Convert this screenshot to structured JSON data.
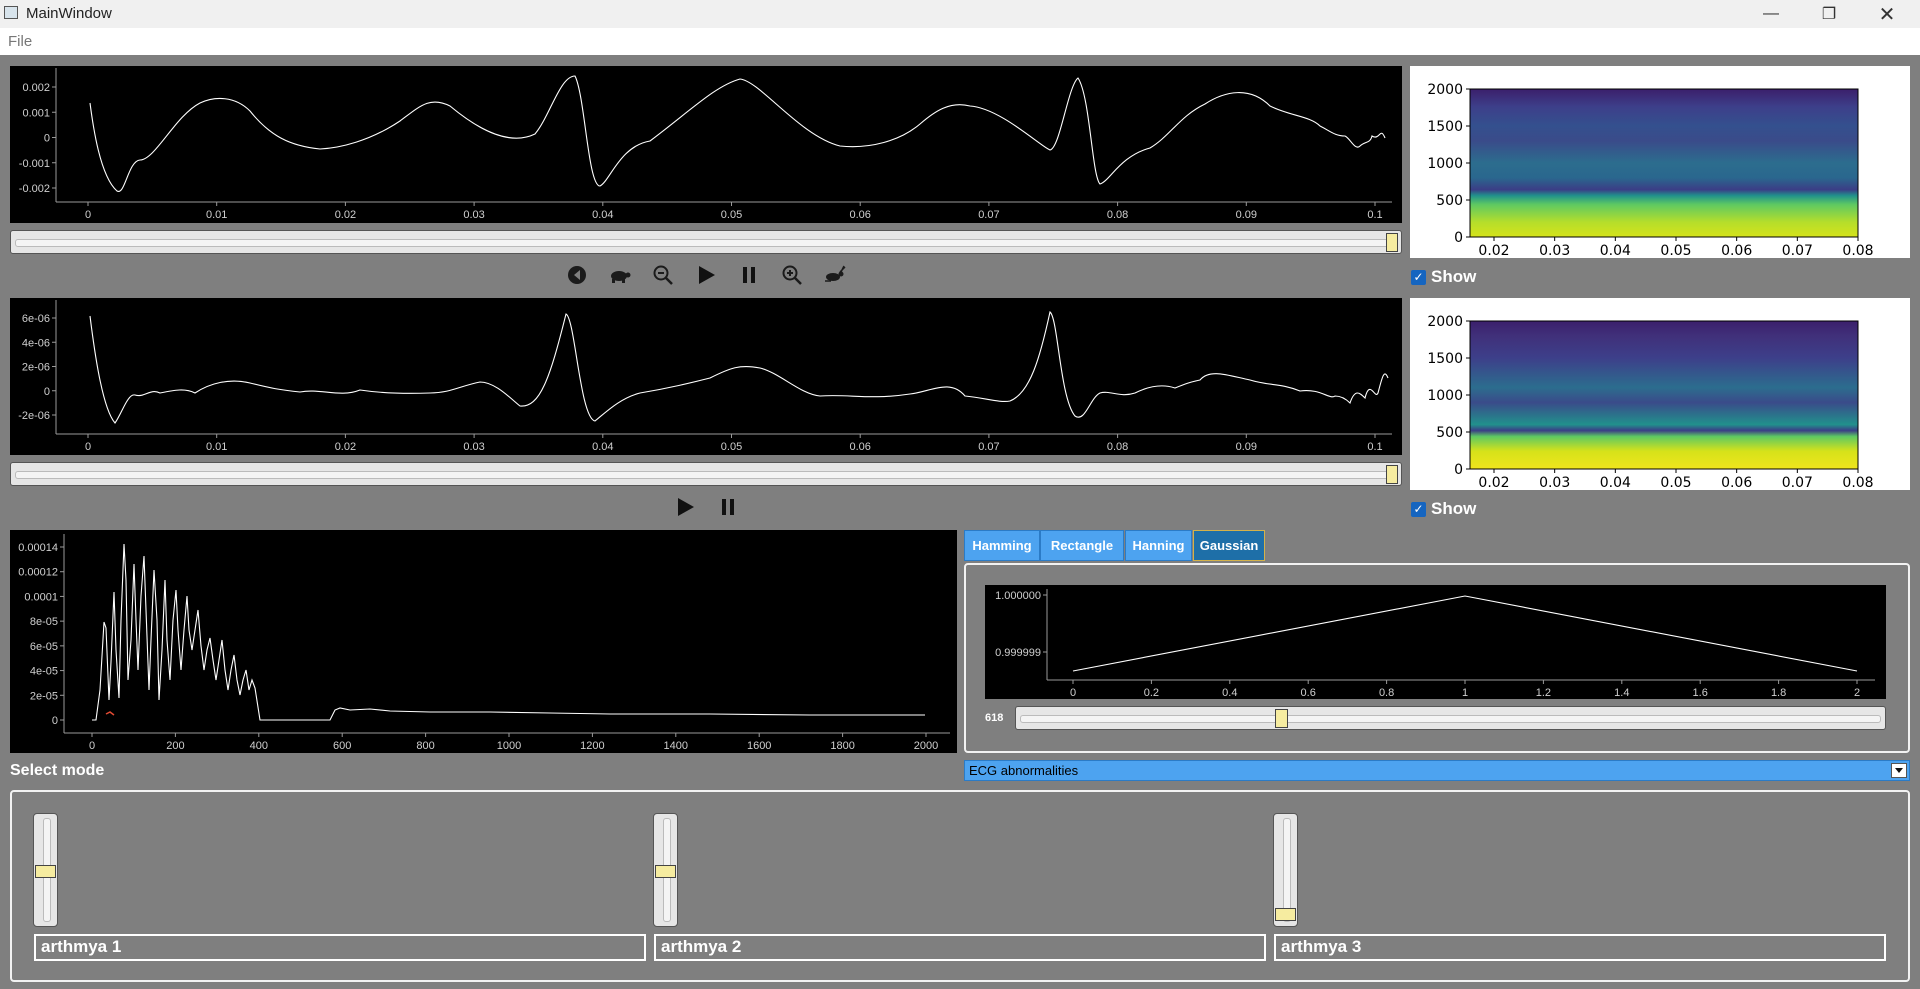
{
  "window": {
    "title": "MainWindow",
    "minimize_icon": "minimize-icon",
    "maximize_icon": "restore-icon",
    "close_icon": "close-icon"
  },
  "menu": {
    "file": "File"
  },
  "colors": {
    "background": "#7f7f7f",
    "plot_bg": "#000000",
    "slider_handle": "#f6eca0",
    "tab": "#4da3f0",
    "tab_active": "#1e6fa8",
    "checkbox": "#1565c0"
  },
  "signal_plot_1": {
    "y_ticks": [
      "0.002",
      "0.001",
      "0",
      "-0.001",
      "-0.002"
    ],
    "x_ticks": [
      "0",
      "0.01",
      "0.02",
      "0.03",
      "0.04",
      "0.05",
      "0.06",
      "0.07",
      "0.08",
      "0.09",
      "0.1"
    ]
  },
  "signal_plot_2": {
    "y_ticks": [
      "6e-06",
      "4e-06",
      "2e-06",
      "0",
      "-2e-06"
    ],
    "x_ticks": [
      "0",
      "0.01",
      "0.02",
      "0.03",
      "0.04",
      "0.05",
      "0.06",
      "0.07",
      "0.08",
      "0.09",
      "0.1"
    ]
  },
  "time_slider_1": {
    "position": 1.0
  },
  "time_slider_2": {
    "position": 1.0
  },
  "toolbar_1": {
    "icons": [
      "rewind-icon",
      "slow-turtle-icon",
      "zoom-out-icon",
      "play-icon",
      "pause-icon",
      "zoom-in-icon",
      "fast-rabbit-icon"
    ]
  },
  "toolbar_2": {
    "icons": [
      "play-icon",
      "pause-icon"
    ]
  },
  "spectrogram_1": {
    "y_ticks": [
      "2000",
      "1500",
      "1000",
      "500",
      "0"
    ],
    "x_ticks": [
      "0.02",
      "0.03",
      "0.04",
      "0.05",
      "0.06",
      "0.07",
      "0.08"
    ],
    "show_label": "Show",
    "show_checked": true
  },
  "spectrogram_2": {
    "y_ticks": [
      "2000",
      "1500",
      "1000",
      "500",
      "0"
    ],
    "x_ticks": [
      "0.02",
      "0.03",
      "0.04",
      "0.05",
      "0.06",
      "0.07",
      "0.08"
    ],
    "show_label": "Show",
    "show_checked": true
  },
  "frequency_plot": {
    "y_ticks": [
      "0.00014",
      "0.00012",
      "0.0001",
      "8e-05",
      "6e-05",
      "4e-05",
      "2e-05",
      "0"
    ],
    "x_ticks": [
      "0",
      "200",
      "400",
      "600",
      "800",
      "1000",
      "1200",
      "1400",
      "1600",
      "1800",
      "2000"
    ]
  },
  "window_tabs": {
    "items": [
      "Hamming",
      "Rectangle",
      "Hanning",
      "Gaussian"
    ],
    "active": "Gaussian"
  },
  "window_plot": {
    "y_ticks": [
      "1.000000",
      "0.999999"
    ],
    "x_ticks": [
      "0",
      "0.2",
      "0.4",
      "0.6",
      "0.8",
      "1",
      "1.2",
      "1.4",
      "1.6",
      "1.8",
      "2"
    ]
  },
  "std_slider": {
    "value_label": "618",
    "position": 0.3
  },
  "mode": {
    "label": "Select mode",
    "selected": "ECG abnormalities"
  },
  "arrhythmias": [
    {
      "label": "arthmya 1",
      "level": 0.5
    },
    {
      "label": "arthmya 2",
      "level": 0.5
    },
    {
      "label": "arthmya 3",
      "level": 0.05
    }
  ]
}
